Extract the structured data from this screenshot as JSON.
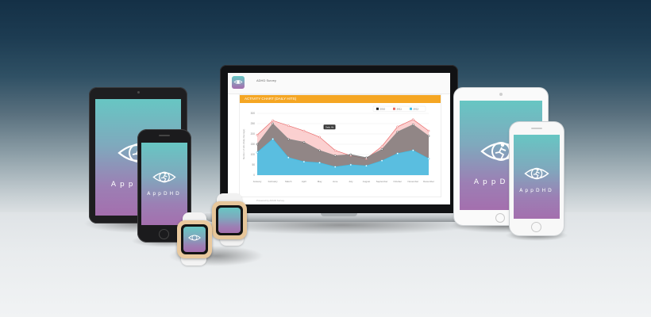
{
  "app": {
    "name": "AppDHD"
  },
  "laptop_screen": {
    "header_label": "ADHD Survey",
    "chart_banner": "ACTIVITY CHART (DAILY HITS)",
    "tooltip": "Daily Hit",
    "footnote": "Powered by ADHD Survey"
  },
  "chart_data": {
    "type": "area",
    "title": "ACTIVITY CHART (DAILY HITS)",
    "ylabel": "Number of Hits (Daily Average)",
    "xlabel": "",
    "categories": [
      "January",
      "February",
      "March",
      "April",
      "May",
      "June",
      "July",
      "August",
      "September",
      "October",
      "November",
      "December"
    ],
    "series": [
      {
        "name": "2010",
        "color": "#8a8a8a",
        "values": [
          150,
          250,
          175,
          160,
          120,
          95,
          100,
          85,
          125,
          210,
          245,
          190
        ]
      },
      {
        "name": "2011",
        "color": "#e86a6a",
        "values": [
          195,
          265,
          240,
          215,
          185,
          120,
          95,
          80,
          140,
          235,
          270,
          215
        ]
      },
      {
        "name": "2012",
        "color": "#3fbfe8",
        "values": [
          110,
          175,
          85,
          65,
          60,
          40,
          50,
          45,
          70,
          105,
          120,
          80
        ]
      }
    ],
    "ylim": [
      0,
      300
    ],
    "yticks": [
      0,
      50,
      100,
      150,
      200,
      250,
      300
    ],
    "legend": "top-right",
    "grid": true
  },
  "colors": {
    "chart_header": "#f5a623",
    "series_2010": "#8a8a8a",
    "series_2011": "#e86a6a",
    "series_2012": "#3fbfe8"
  }
}
